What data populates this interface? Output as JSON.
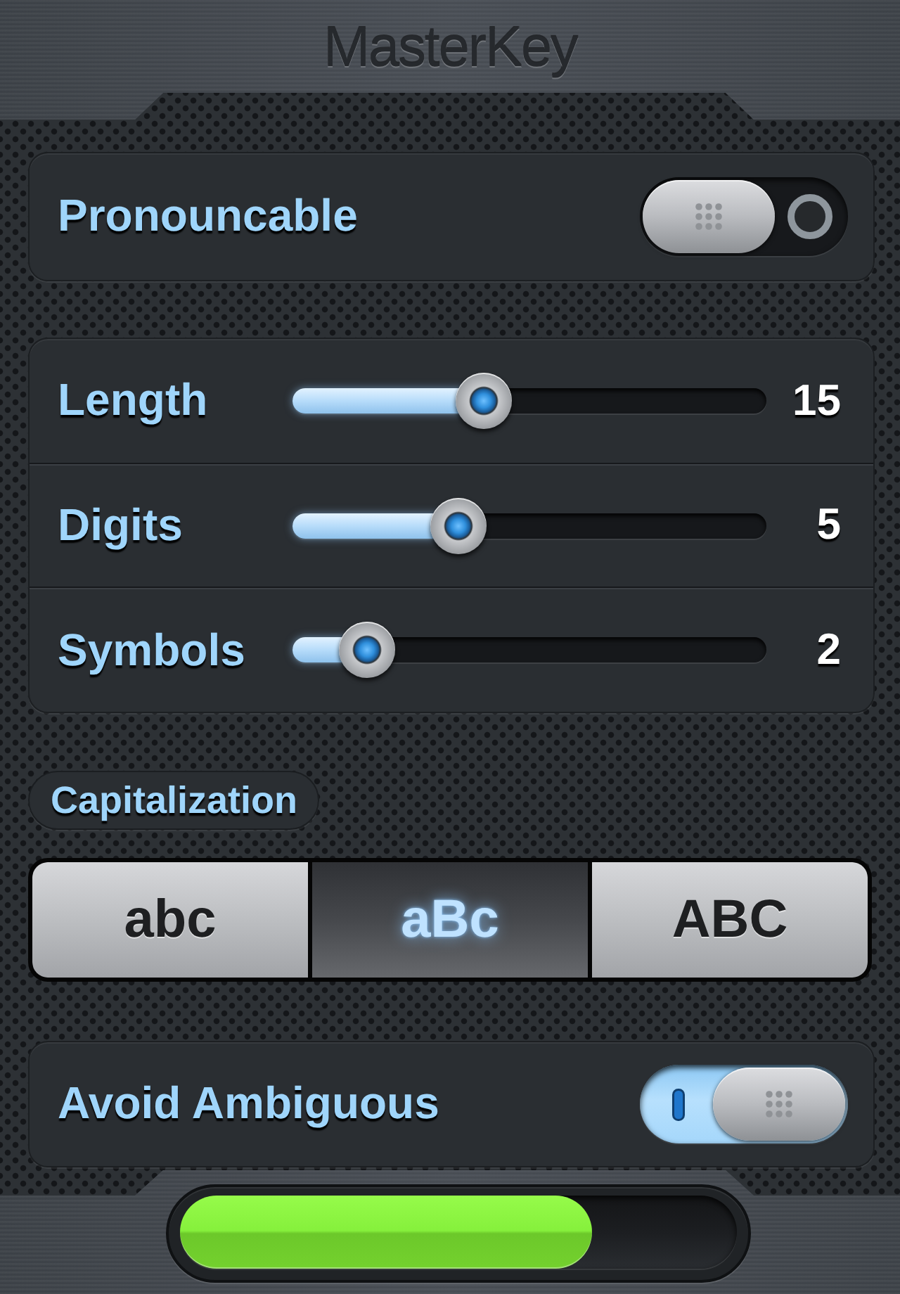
{
  "window": {
    "title": "MasterKey"
  },
  "pronounceable": {
    "label": "Pronouncable",
    "on": false
  },
  "sliders": [
    {
      "label": "Length",
      "level": 0.39,
      "reading": "15"
    },
    {
      "label": "Digits",
      "level": 0.33,
      "reading": "5"
    },
    {
      "label": "Symbols",
      "level": 0.11,
      "reading": "2"
    }
  ],
  "capitalization": {
    "label": "Capitalization",
    "segments": [
      {
        "label": "abc",
        "selected": false
      },
      {
        "label": "aBc",
        "selected": true
      },
      {
        "label": "ABC",
        "selected": false
      }
    ]
  },
  "avoid_ambiguous": {
    "label": "Avoid Ambiguous",
    "on": true
  },
  "strength_meter": {
    "level": 0.74
  }
}
